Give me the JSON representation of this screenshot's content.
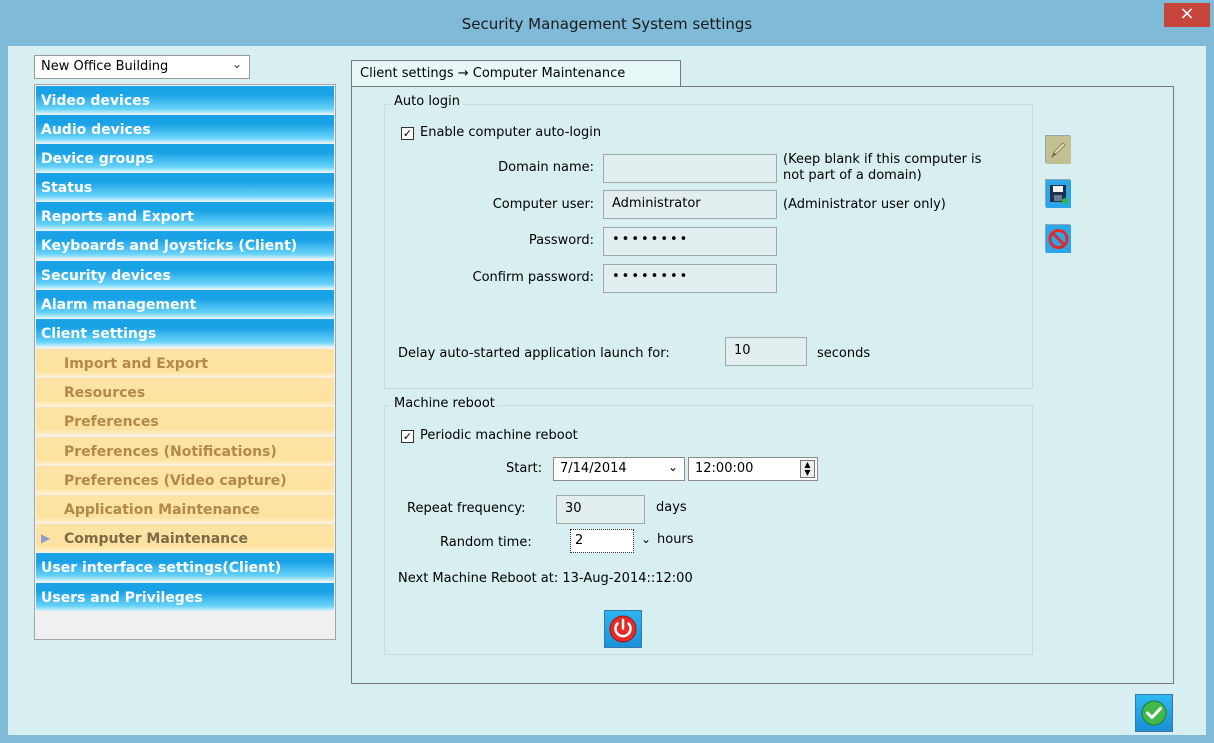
{
  "window": {
    "title": "Security Management System settings",
    "close_glyph": "×"
  },
  "site_selector": {
    "value": "New Office Building",
    "arrow": "⌄"
  },
  "nav": {
    "items": [
      {
        "label": "Video devices"
      },
      {
        "label": "Audio devices"
      },
      {
        "label": "Device groups"
      },
      {
        "label": "Status"
      },
      {
        "label": "Reports and Export"
      },
      {
        "label": "Keyboards and Joysticks (Client)"
      },
      {
        "label": "Security devices"
      },
      {
        "label": "Alarm management"
      },
      {
        "label": "Client settings"
      }
    ],
    "subitems": [
      {
        "label": "Import and Export"
      },
      {
        "label": "Resources"
      },
      {
        "label": "Preferences"
      },
      {
        "label": "Preferences (Notifications)"
      },
      {
        "label": "Preferences (Video capture)"
      },
      {
        "label": "Application Maintenance"
      },
      {
        "label": "Computer Maintenance",
        "selected": true
      }
    ],
    "trailing_items": [
      {
        "label": "User interface settings(Client)"
      },
      {
        "label": "Users and Privileges"
      }
    ],
    "selected_marker": "▶"
  },
  "tab": {
    "label": "Client settings → Computer Maintenance"
  },
  "auto_login": {
    "group_label": "Auto login",
    "enable_checkbox": {
      "label": "Enable computer auto-login",
      "checked": true,
      "mark": "✓"
    },
    "domain": {
      "label": "Domain name:",
      "value": "",
      "hint_line1": "(Keep blank if this computer is",
      "hint_line2": "not part of a domain)"
    },
    "user": {
      "label": "Computer user:",
      "value": "Administrator",
      "hint": "(Administrator user only)"
    },
    "password": {
      "label": "Password:",
      "value": "••••••••"
    },
    "confirm": {
      "label": "Confirm password:",
      "value": "••••••••"
    },
    "delay": {
      "label": "Delay auto-started application launch for:",
      "value": "10",
      "unit": "seconds"
    }
  },
  "machine_reboot": {
    "group_label": "Machine reboot",
    "periodic_checkbox": {
      "label": "Periodic machine reboot",
      "checked": true,
      "mark": "✓"
    },
    "start": {
      "label": "Start:",
      "date": "7/14/2014",
      "time": "12:00:00"
    },
    "repeat": {
      "label": "Repeat frequency:",
      "value": "30",
      "unit": "days"
    },
    "random": {
      "label": "Random time:",
      "value": "2",
      "unit": "hours"
    },
    "next": "Next Machine Reboot at: 13-Aug-2014::12:00"
  },
  "icons": {
    "edit": "pencil-icon",
    "save": "save-icon",
    "cancel": "cancel-icon",
    "reboot": "power-icon",
    "ok": "checkmark-icon"
  },
  "colors": {
    "title_bar": "#7fbad8",
    "close_button": "#c7453b",
    "nav_blue": "#1ba3e8",
    "nav_yellow": "#fde29f",
    "panel_bg": "#d7eff0"
  }
}
